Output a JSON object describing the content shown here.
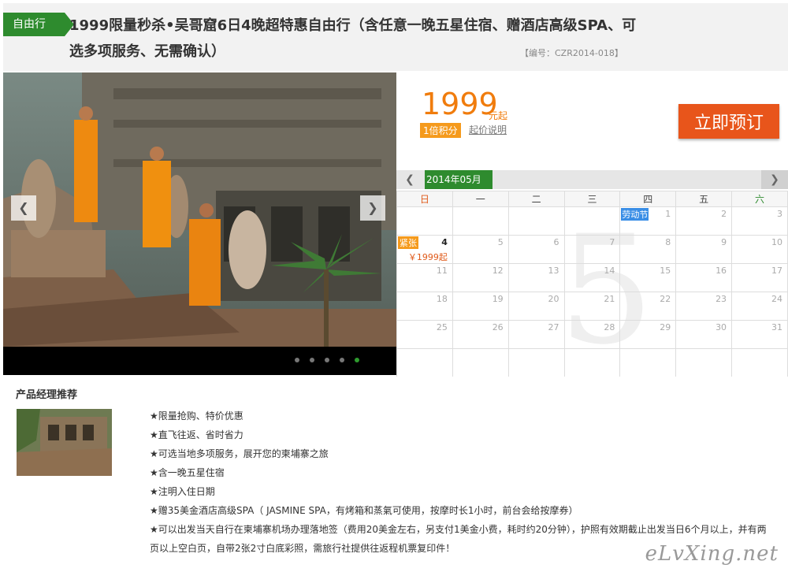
{
  "header": {
    "tag": "自由行",
    "title": "1999限量秒杀•吴哥窟6日4晚超特惠自由行（含任意一晚五星住宿、赠酒店高级SPA、可选多项服务、无需确认）",
    "code": "【编号：CZR2014-018】"
  },
  "gallery": {
    "prev_label": "❮",
    "next_label": "❯",
    "slide_count": 5,
    "active_slide": 5
  },
  "price": {
    "amount": "1999",
    "unit": "元起",
    "points": "1倍积分",
    "explain": "起价说明",
    "book_label": "立即预订"
  },
  "calendar": {
    "prev": "❮",
    "next": "❯",
    "month_label": "2014年05月",
    "big_month": "5",
    "weekdays": [
      "日",
      "一",
      "二",
      "三",
      "四",
      "五",
      "六"
    ],
    "weeks": [
      [
        {
          "d": ""
        },
        {
          "d": ""
        },
        {
          "d": ""
        },
        {
          "d": ""
        },
        {
          "d": "1",
          "holiday": "劳动节"
        },
        {
          "d": "2"
        },
        {
          "d": "3"
        }
      ],
      [
        {
          "d": "4",
          "tag": "紧张",
          "price": "￥1999起",
          "strong": true
        },
        {
          "d": "5"
        },
        {
          "d": "6"
        },
        {
          "d": "7"
        },
        {
          "d": "8"
        },
        {
          "d": "9"
        },
        {
          "d": "10"
        }
      ],
      [
        {
          "d": "11"
        },
        {
          "d": "12"
        },
        {
          "d": "13"
        },
        {
          "d": "14"
        },
        {
          "d": "15"
        },
        {
          "d": "16"
        },
        {
          "d": "17"
        }
      ],
      [
        {
          "d": "18"
        },
        {
          "d": "19"
        },
        {
          "d": "20"
        },
        {
          "d": "21"
        },
        {
          "d": "22"
        },
        {
          "d": "23"
        },
        {
          "d": "24"
        }
      ],
      [
        {
          "d": "25"
        },
        {
          "d": "26"
        },
        {
          "d": "27"
        },
        {
          "d": "28"
        },
        {
          "d": "29"
        },
        {
          "d": "30"
        },
        {
          "d": "31"
        }
      ],
      [
        {
          "d": ""
        },
        {
          "d": ""
        },
        {
          "d": ""
        },
        {
          "d": ""
        },
        {
          "d": ""
        },
        {
          "d": ""
        },
        {
          "d": ""
        }
      ]
    ]
  },
  "recommend": {
    "title": "产品经理推荐",
    "items": [
      "★限量抢购、特价优惠",
      "★直飞往返、省时省力",
      "★可选当地多项服务，展开您的柬埔寨之旅",
      "★含一晚五星住宿",
      "★注明入住日期",
      "★赠35美金酒店高级SPA（ JASMINE SPA，有烤箱和蒸氣可使用，按摩时长1小时，前台会给按摩券）",
      "★可以出发当天自行在柬埔寨机场办理落地签（费用20美金左右，另支付1美金小费，耗时约20分钟），护照有效期截止出发当日6个月以上，并有两页以上空白页，自带2张2寸白底彩照，需旅行社提供往返程机票复印件！"
    ],
    "watermark": "eLvXing.net"
  },
  "colors": {
    "green": "#2e8b2e",
    "orange": "#f07c0d",
    "button": "#e8551b",
    "holiday": "#3a8ee6"
  }
}
